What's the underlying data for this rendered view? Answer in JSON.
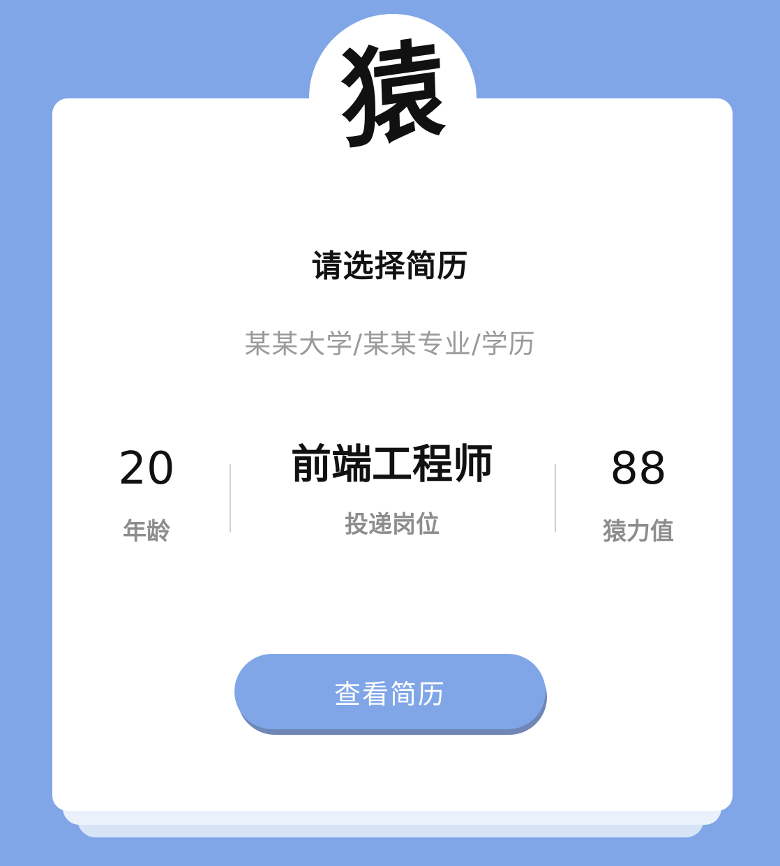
{
  "avatar": {
    "glyph": "猿",
    "icon": "calligraphy-avatar-icon"
  },
  "title": "请选择简历",
  "subtitle": "某某大学/某某专业/学历",
  "stats": {
    "age": {
      "value": "20",
      "label": "年龄"
    },
    "role": {
      "value": "前端工程师",
      "label": "投递岗位"
    },
    "score": {
      "value": "88",
      "label": "猿力值"
    }
  },
  "button": {
    "label": "查看简历"
  },
  "colors": {
    "background": "#80a6e7",
    "card": "#ffffff",
    "button": "#80a6e7",
    "button_shadow": "#6f86b6",
    "title_text": "#111111",
    "muted_text": "#9a9a9a"
  }
}
